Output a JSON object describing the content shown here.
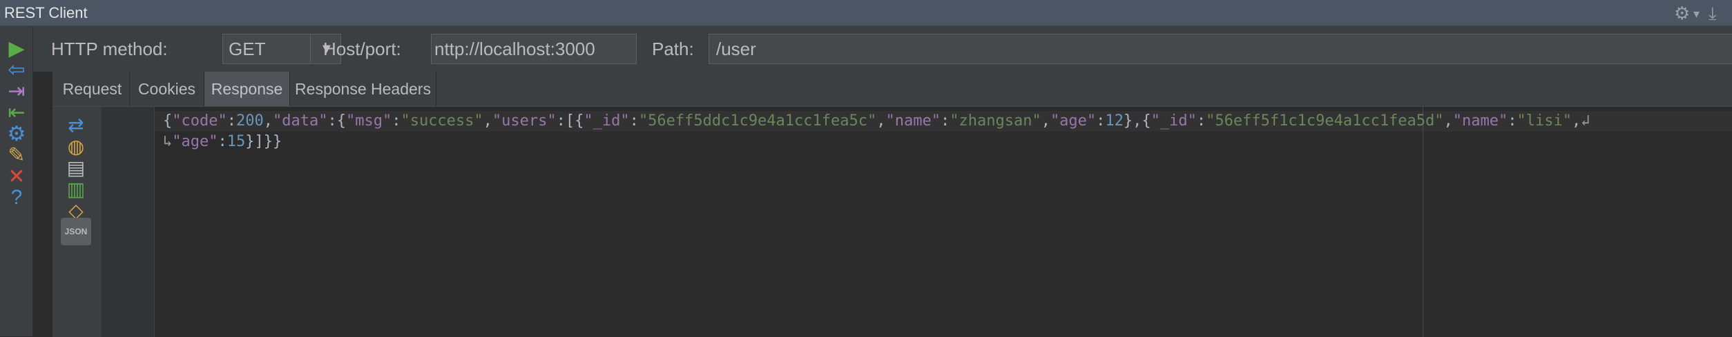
{
  "window": {
    "title": "REST Client"
  },
  "titlebar_icons": {
    "settings": "gear-icon",
    "settings_dropdown": "▾",
    "hide": "hide-icon"
  },
  "sidebar": {
    "icons": [
      {
        "name": "run-icon",
        "glyph": "▶",
        "color": "#5aac47"
      },
      {
        "name": "back-icon",
        "glyph": "⇦",
        "color": "#4a90d9"
      },
      {
        "name": "export-icon",
        "glyph": "⇥",
        "color": "#b07cc6"
      },
      {
        "name": "import-icon",
        "glyph": "⇤",
        "color": "#5aac47"
      },
      {
        "name": "configure-icon",
        "glyph": "⚙",
        "color": "#4a90d9"
      },
      {
        "name": "tools-icon",
        "glyph": "✎",
        "color": "#d4a84b"
      },
      {
        "name": "close-icon",
        "glyph": "✕",
        "color": "#e0473a"
      },
      {
        "name": "help-icon",
        "glyph": "?",
        "color": "#4a90d9"
      }
    ]
  },
  "toolbar": {
    "method_label": "HTTP method:",
    "method_value": "GET",
    "host_label": "Host/port:",
    "host_value": "nttp://localhost:3000",
    "path_label": "Path:",
    "path_value": "/user"
  },
  "tabs": [
    {
      "label": "Request",
      "active": false
    },
    {
      "label": "Cookies",
      "active": false
    },
    {
      "label": "Response",
      "active": true
    },
    {
      "label": "Response Headers",
      "active": false
    }
  ],
  "response_tools": [
    {
      "name": "reformat-icon",
      "glyph": "⇄",
      "color": "#4a90d9"
    },
    {
      "name": "browser-icon",
      "glyph": "◍",
      "color": "#d9a441"
    },
    {
      "name": "text-view-icon",
      "glyph": "▤",
      "color": "#bbbbbb"
    },
    {
      "name": "html-view-icon",
      "glyph": "▥",
      "color": "#5aac47"
    },
    {
      "name": "xml-view-icon",
      "glyph": "◇",
      "color": "#d9a441"
    },
    {
      "name": "json-view-icon",
      "glyph": "JSON",
      "color": "#bbbbbb"
    }
  ],
  "response": {
    "line1": [
      {
        "t": "{",
        "c": "p"
      },
      {
        "t": "\"code\"",
        "c": "k"
      },
      {
        "t": ":",
        "c": "p"
      },
      {
        "t": "200",
        "c": "n"
      },
      {
        "t": ",",
        "c": "p"
      },
      {
        "t": "\"data\"",
        "c": "k"
      },
      {
        "t": ":{",
        "c": "p"
      },
      {
        "t": "\"msg\"",
        "c": "k"
      },
      {
        "t": ":",
        "c": "p"
      },
      {
        "t": "\"success\"",
        "c": "s"
      },
      {
        "t": ",",
        "c": "p"
      },
      {
        "t": "\"users\"",
        "c": "k"
      },
      {
        "t": ":[{",
        "c": "p"
      },
      {
        "t": "\"_id\"",
        "c": "k"
      },
      {
        "t": ":",
        "c": "p"
      },
      {
        "t": "\"56eff5ddc1c9e4a1cc1fea5c\"",
        "c": "s"
      },
      {
        "t": ",",
        "c": "p"
      },
      {
        "t": "\"name\"",
        "c": "k"
      },
      {
        "t": ":",
        "c": "p"
      },
      {
        "t": "\"zhangsan\"",
        "c": "s"
      },
      {
        "t": ",",
        "c": "p"
      },
      {
        "t": "\"age\"",
        "c": "k"
      },
      {
        "t": ":",
        "c": "p"
      },
      {
        "t": "12",
        "c": "n"
      },
      {
        "t": "},{",
        "c": "p"
      },
      {
        "t": "\"_id\"",
        "c": "k"
      },
      {
        "t": ":",
        "c": "p"
      },
      {
        "t": "\"56eff5f1c1c9e4a1cc1fea5d\"",
        "c": "s"
      },
      {
        "t": ",",
        "c": "p"
      },
      {
        "t": "\"name\"",
        "c": "k"
      },
      {
        "t": ":",
        "c": "p"
      },
      {
        "t": "\"lisi\"",
        "c": "s"
      },
      {
        "t": ",",
        "c": "p"
      },
      {
        "t": "↲",
        "c": "w"
      }
    ],
    "line2": [
      {
        "t": "↳",
        "c": "w"
      },
      {
        "t": "\"age\"",
        "c": "k"
      },
      {
        "t": ":",
        "c": "p"
      },
      {
        "t": "15",
        "c": "n"
      },
      {
        "t": "}]}}",
        "c": "p"
      }
    ]
  }
}
